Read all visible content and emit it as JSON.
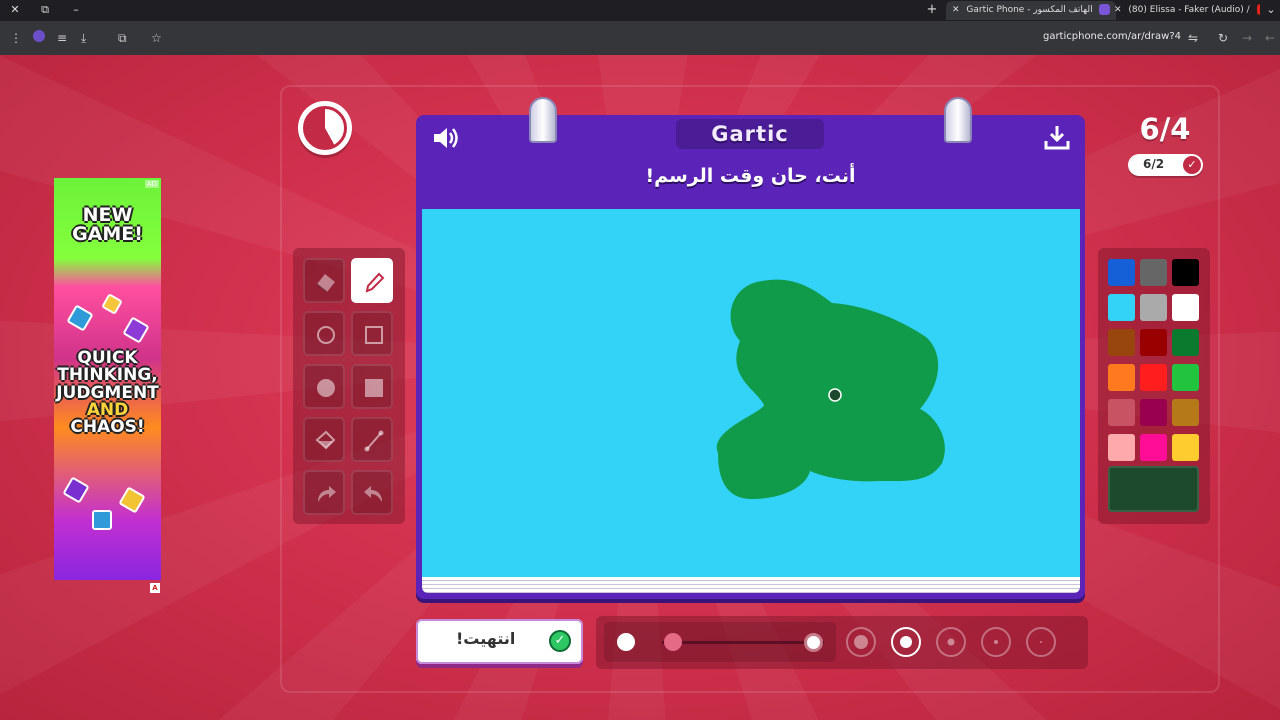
{
  "browser": {
    "tabs": [
      {
        "title": "Gartic Phone - الهاتف المكسور",
        "active": true
      },
      {
        "title": "(80) Elissa - Faker (Audio) /",
        "active": false
      }
    ],
    "url": "garticphone.com/ar/draw?4"
  },
  "game": {
    "logo": "Gartic",
    "prompt": "أنت، حان وقت الرسم!",
    "score": "6/4",
    "players_done": "6/2",
    "done_button": "انتهيت!",
    "timer_remaining_fraction": 0.58
  },
  "ad": {
    "tag": "AD",
    "headline": "NEW GAME!",
    "tagline": [
      "QUICK",
      "THINKING,",
      "JUDGMENT",
      "AND",
      "CHAOS!"
    ]
  },
  "tools": [
    {
      "name": "eraser-tool",
      "icon": "eraser-icon"
    },
    {
      "name": "pen-tool",
      "icon": "pen-icon",
      "selected": true
    },
    {
      "name": "ellipse-outline-tool",
      "icon": "circle-outline-icon"
    },
    {
      "name": "rectangle-outline-tool",
      "icon": "square-outline-icon"
    },
    {
      "name": "ellipse-fill-tool",
      "icon": "circle-filled-icon"
    },
    {
      "name": "rectangle-fill-tool",
      "icon": "square-filled-icon"
    },
    {
      "name": "bucket-tool",
      "icon": "bucket-icon"
    },
    {
      "name": "line-tool",
      "icon": "line-icon"
    },
    {
      "name": "undo-tool",
      "icon": "undo-icon"
    },
    {
      "name": "redo-tool",
      "icon": "redo-icon"
    }
  ],
  "palette": {
    "colors": [
      "#1560d6",
      "#666666",
      "#000000",
      "#33d3f8",
      "#aaaaaa",
      "#ffffff",
      "#99450e",
      "#990000",
      "#0a7a2e",
      "#ff7a1f",
      "#ff1d1d",
      "#22c33f",
      "#c75363",
      "#99004d",
      "#b5791a",
      "#ffaaaa",
      "#ff0d96",
      "#ffcc2f"
    ],
    "current": "#1d4a2c"
  },
  "canvas": {
    "background": "#33d3f8",
    "blob_color": "#109b4b"
  },
  "brush": {
    "opacity_fraction": 0.05,
    "selected_size_index": 1,
    "sizes": 5
  }
}
